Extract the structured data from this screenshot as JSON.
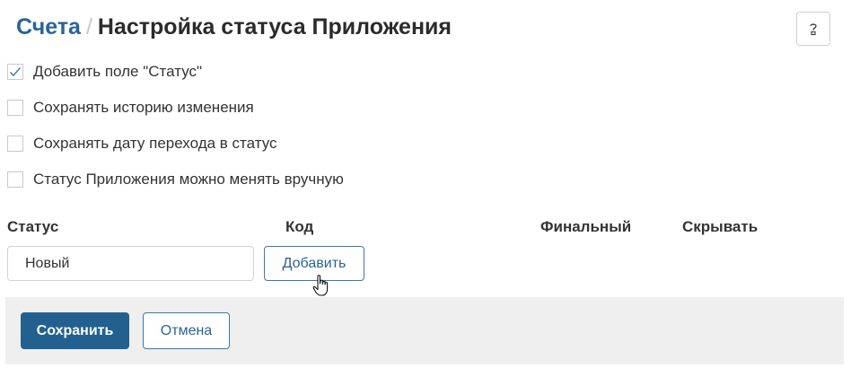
{
  "header": {
    "breadcrumb_link": "Счета",
    "separator": "/",
    "title": "Настройка статуса Приложения",
    "help_icon": "question-icon"
  },
  "options": [
    {
      "label": "Добавить поле \"Статус\"",
      "checked": true
    },
    {
      "label": "Сохранять историю изменения",
      "checked": false
    },
    {
      "label": "Сохранять дату перехода в статус",
      "checked": false
    },
    {
      "label": "Статус Приложения можно менять вручную",
      "checked": false
    }
  ],
  "table": {
    "columns": [
      "Статус",
      "Код",
      "Финальный",
      "Скрывать"
    ]
  },
  "status_input": {
    "value": "Новый"
  },
  "add_button": {
    "label": "Добавить"
  },
  "footer": {
    "save_label": "Сохранить",
    "cancel_label": "Отмена"
  },
  "colors": {
    "accent": "#22618f",
    "link": "#2a6496",
    "footer_bg": "#efefef"
  }
}
